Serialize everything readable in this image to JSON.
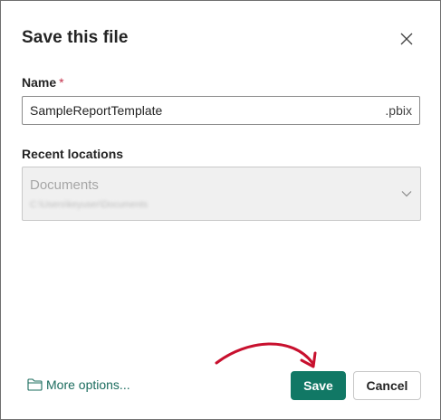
{
  "dialog": {
    "title": "Save this file",
    "close_icon": "close-icon"
  },
  "name_field": {
    "label": "Name",
    "required_mark": "*",
    "value": "SampleReportTemplate",
    "extension": ".pbix"
  },
  "recent_locations": {
    "label": "Recent locations",
    "selected_name": "Documents",
    "selected_path": "C:\\Users\\keyuser\\Documents",
    "chevron_icon": "chevron-down-icon"
  },
  "footer": {
    "more_options_label": "More options...",
    "more_options_icon": "folder-icon",
    "save_label": "Save",
    "cancel_label": "Cancel"
  },
  "colors": {
    "accent": "#117865",
    "link": "#1b6c5e",
    "required": "#c4314b",
    "annotation_arrow": "#c8102e"
  }
}
